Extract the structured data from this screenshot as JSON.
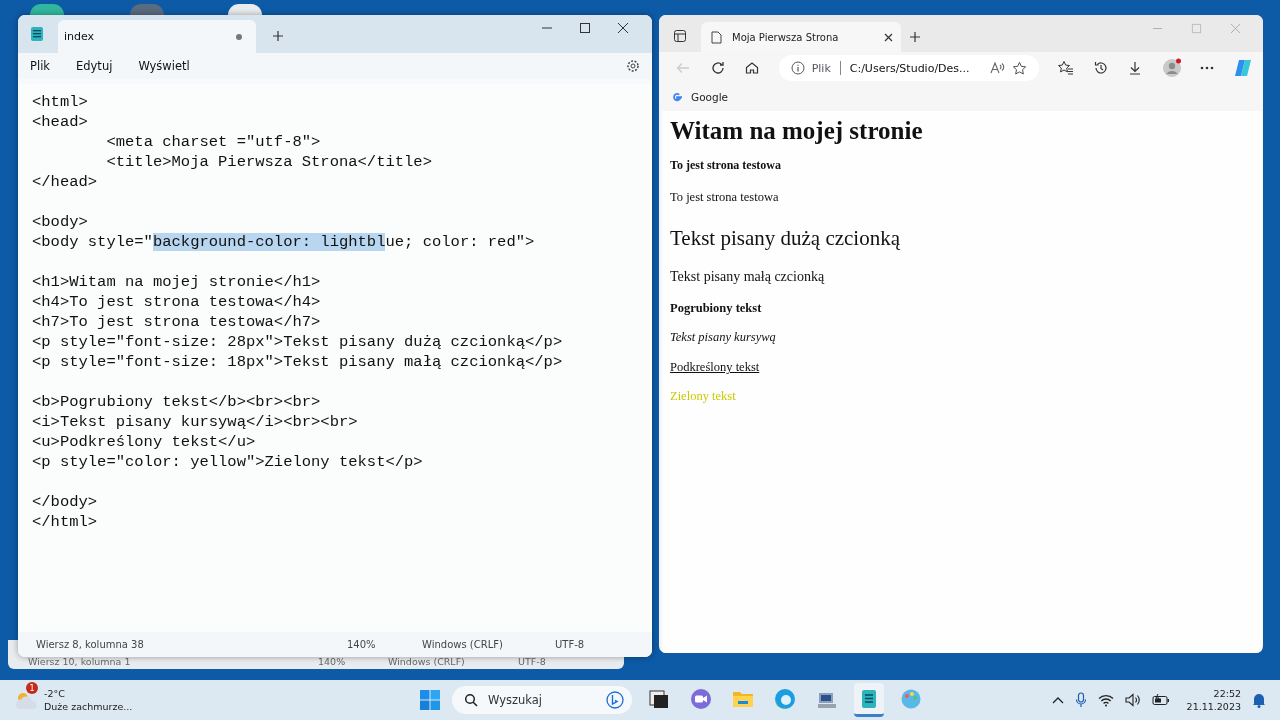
{
  "back_window": {
    "status": [
      "Wiersz 10, kolumna 1",
      "140%",
      "Windows (CRLF)",
      "UTF-8"
    ]
  },
  "notepad": {
    "tabs": [
      {
        "label": "index",
        "modified": true,
        "selected": true
      }
    ],
    "menu": [
      "Plik",
      "Edytuj",
      "Wyświetl"
    ],
    "code_blocks": [
      [
        [
          {
            "text": "<html>",
            "selected": false
          }
        ],
        [
          {
            "text": "<head>",
            "selected": false
          }
        ],
        [
          {
            "text": "\t<meta charset =\"utf-8\">",
            "selected": false
          }
        ],
        [
          {
            "text": "\t<title>Moja Pierwsza Strona</title>",
            "selected": false
          }
        ],
        [
          {
            "text": "</head>",
            "selected": false
          }
        ]
      ],
      [
        [
          {
            "text": "<body>",
            "selected": false
          }
        ],
        [
          {
            "text": "<body style=\"",
            "selected": false
          },
          {
            "text": "background-color: lightbl",
            "selected": true
          },
          {
            "text": "ue; color: red\">",
            "selected": false
          }
        ]
      ],
      [
        [
          {
            "text": "<h1>Witam na mojej stronie</h1>",
            "selected": false
          }
        ],
        [
          {
            "text": "<h4>To jest strona testowa</h4>",
            "selected": false
          }
        ],
        [
          {
            "text": "<h7>To jest strona testowa</h7>",
            "selected": false
          }
        ],
        [
          {
            "text": "<p style=\"font-size: 28px\">Tekst pisany dużą czcionką</p>",
            "selected": false
          }
        ],
        [
          {
            "text": "<p style=\"font-size: 18px\">Tekst pisany małą czcionką</p>",
            "selected": false
          }
        ]
      ],
      [
        [
          {
            "text": "<b>Pogrubiony tekst</b><br><br>",
            "selected": false
          }
        ],
        [
          {
            "text": "<i>Tekst pisany kursywą</i><br><br>",
            "selected": false
          }
        ],
        [
          {
            "text": "<u>Podkreślony tekst</u>",
            "selected": false
          }
        ],
        [
          {
            "text": "<p style=\"color: yellow\">Zielony tekst</p>",
            "selected": false
          }
        ]
      ],
      [
        [
          {
            "text": "</body>",
            "selected": false
          }
        ],
        [
          {
            "text": "</html>",
            "selected": false
          }
        ]
      ]
    ],
    "status": [
      "Wiersz 8, kolumna 38",
      "140%",
      "Windows (CRLF)",
      "UTF-8"
    ]
  },
  "browser": {
    "tabs": [
      {
        "label": "Moja Pierwsza Strona",
        "selected": true
      }
    ],
    "address": {
      "scheme": "Plik",
      "value": "C:/Users/Studio/Des..."
    },
    "favorites": [
      "Google"
    ],
    "page": [
      {
        "kind": "h1",
        "text": "Witam na mojej stronie"
      },
      {
        "kind": "h4",
        "text": "To jest strona testowa"
      },
      {
        "kind": "plain",
        "text": "To jest strona testowa"
      },
      {
        "kind": "large",
        "text": "Tekst pisany dużą czcionką"
      },
      {
        "kind": "medium",
        "text": "Tekst pisany małą czcionką"
      },
      {
        "kind": "bold",
        "text": "Pogrubiony tekst"
      },
      {
        "kind": "italic",
        "text": "Tekst pisany kursywą"
      },
      {
        "kind": "underline",
        "text": "Podkreślony tekst"
      },
      {
        "kind": "plain",
        "text": "Zielony tekst",
        "color": "#caca00"
      }
    ]
  },
  "taskbar": {
    "weather": {
      "badge": "1",
      "temperature": "-2°C",
      "condition": "Duże zachmurze..."
    },
    "search": {
      "placeholder": "Wyszukaj"
    },
    "apps": [
      {
        "kind": "taskview",
        "active": false
      },
      {
        "kind": "teams",
        "active": false
      },
      {
        "kind": "explorer",
        "active": false
      },
      {
        "kind": "edge",
        "active": false
      },
      {
        "kind": "installer",
        "active": false
      },
      {
        "kind": "notepad",
        "active": true
      },
      {
        "kind": "paint",
        "active": false
      }
    ],
    "time": "22:52",
    "date": "21.11.2023"
  }
}
